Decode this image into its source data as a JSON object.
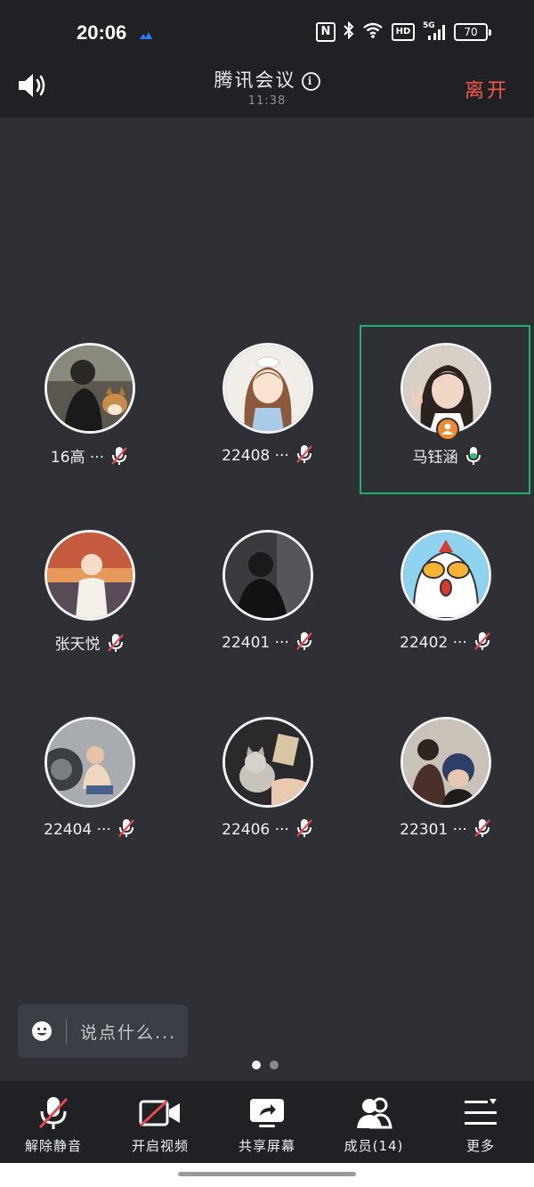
{
  "status_bar": {
    "time": "20:06",
    "nfc": "N",
    "hd": "HD",
    "network": "5G",
    "battery": "70"
  },
  "header": {
    "title": "腾讯会议",
    "timer": "11:38",
    "leave": "离开"
  },
  "participants": [
    {
      "name": "16高 ···",
      "mic": "muted"
    },
    {
      "name": "22408 ···",
      "mic": "muted"
    },
    {
      "name": "马钰涵",
      "mic": "active",
      "host": true,
      "speaking": true
    },
    {
      "name": "张天悦",
      "mic": "muted"
    },
    {
      "name": "22401 ···",
      "mic": "muted"
    },
    {
      "name": "22402 ···",
      "mic": "muted"
    },
    {
      "name": "22404 ···",
      "mic": "muted"
    },
    {
      "name": "22406 ···",
      "mic": "muted"
    },
    {
      "name": "22301 ···",
      "mic": "muted"
    }
  ],
  "chat": {
    "placeholder": "说点什么..."
  },
  "pager": {
    "pages": 2,
    "current": 1
  },
  "toolbar": {
    "unmute": "解除静音",
    "video": "开启视频",
    "share": "共享屏幕",
    "members": "成员(14)",
    "more": "更多"
  },
  "colors": {
    "background": "#2e3035",
    "bar": "#1f2124",
    "leave": "#f4564c",
    "active_border": "#19b36b",
    "mic_muted": "#e5484d",
    "mic_active": "#2fbf71",
    "host_badge": "#f08a30"
  }
}
